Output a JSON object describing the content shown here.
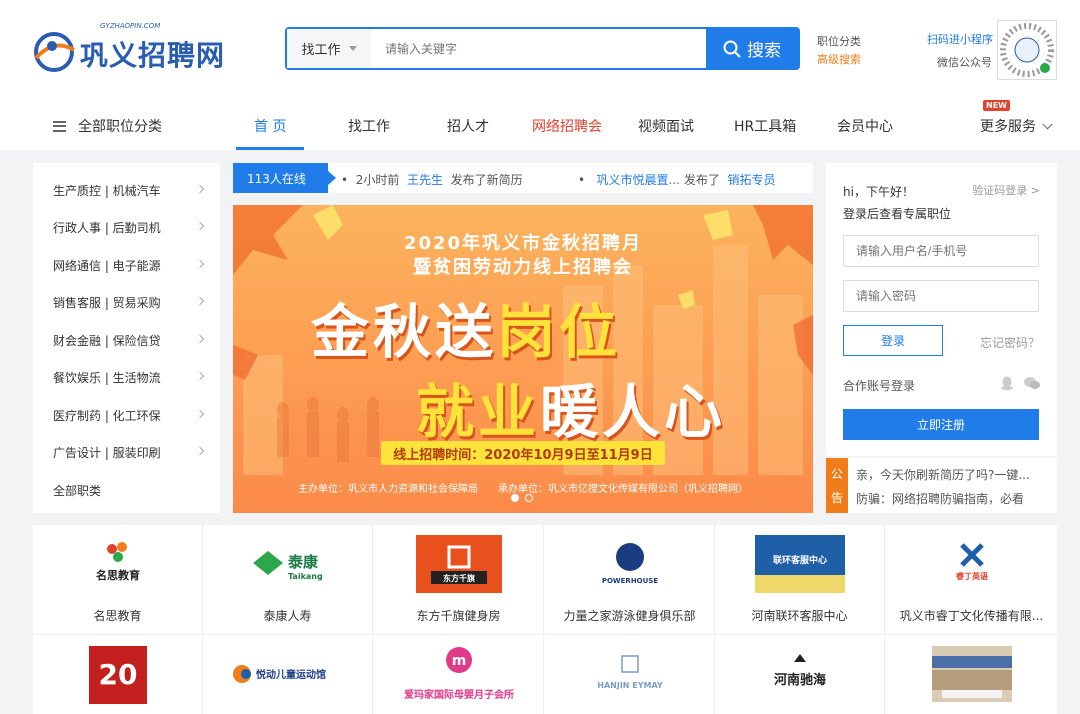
{
  "header": {
    "logo_text": "巩义招聘网",
    "logo_en": "GYZHAOPIN.COM",
    "search_type": "找工作",
    "search_placeholder": "请输入关键字",
    "search_button": "搜索",
    "link_category": "职位分类",
    "link_advanced": "高级搜索",
    "qr_miniprogram": "扫码进小程序",
    "qr_wechat": "微信公众号"
  },
  "nav": {
    "all_categories": "全部职位分类",
    "items": [
      "首 页",
      "找工作",
      "招人才",
      "网络招聘会",
      "视频面试",
      "HR工具箱",
      "会员中心"
    ],
    "more": "更多服务",
    "new_badge": "NEW",
    "active_color": "#1f7ce8",
    "highlight_color": "#e3402d"
  },
  "categories": [
    "生产质控 | 机械汽车",
    "行政人事 | 后勤司机",
    "网络通信 | 电子能源",
    "销售客服 | 贸易采购",
    "财会金融 | 保险信贷",
    "餐饮娱乐 | 生活物流",
    "医疗制药 | 化工环保",
    "广告设计 | 服装印刷",
    "全部职类"
  ],
  "ticker": {
    "online": "113人在线",
    "item1_time": "2小时前",
    "item1_user": "王先生",
    "item1_action": "发布了新简历",
    "item2_company": "巩义市悦晨置...",
    "item2_action": "发布了",
    "item2_job": "销拓专员"
  },
  "banner": {
    "title1": "2020年巩义市金秋招聘月",
    "title2": "暨贫困劳动力线上招聘会",
    "headline1_a": "金秋送",
    "headline1_b": "岗位",
    "headline2_a": "就业",
    "headline2_b": "暖人心",
    "time": "线上招聘时间：2020年10月9日至11月9日",
    "organizers": "主办单位：巩义市人力资源和社会保障局　　承办单位：巩义市亿搜文化传媒有限公司（巩义招聘网）"
  },
  "login": {
    "greeting": "hi，下午好！",
    "code_login": "验证码登录 >",
    "subtitle": "登录后查看专属职位",
    "username_placeholder": "请输入用户名/手机号",
    "password_placeholder": "请输入密码",
    "login_button": "登录",
    "forgot": "忘记密码？",
    "partner_login": "合作账号登录",
    "register_button": "立即注册"
  },
  "notice": {
    "tag1": "公",
    "tag2": "告",
    "line1": "亲，今天你刷新简历了吗?一键...",
    "line2": "防骗：网络招聘防骗指南，必看"
  },
  "companies": [
    {
      "name": "名思教育",
      "logo": "名思教育"
    },
    {
      "name": "泰康人寿",
      "logo": "泰康"
    },
    {
      "name": "东方千旗健身房",
      "logo": "东方千旗"
    },
    {
      "name": "力量之家游泳健身俱乐部",
      "logo": "POWERHOUSE"
    },
    {
      "name": "河南联环客服中心",
      "logo": "联环客服中心"
    },
    {
      "name": "巩义市睿丁文化传播有限...",
      "logo": "睿丁英语"
    },
    {
      "name": "",
      "logo": "20"
    },
    {
      "name": "",
      "logo": "悦动儿童运动馆"
    },
    {
      "name": "",
      "logo": "爱玛家国际母婴月子会所"
    },
    {
      "name": "",
      "logo": "HANJIN EYMAY"
    },
    {
      "name": "",
      "logo": "河南驰海"
    },
    {
      "name": "",
      "logo": ""
    }
  ]
}
